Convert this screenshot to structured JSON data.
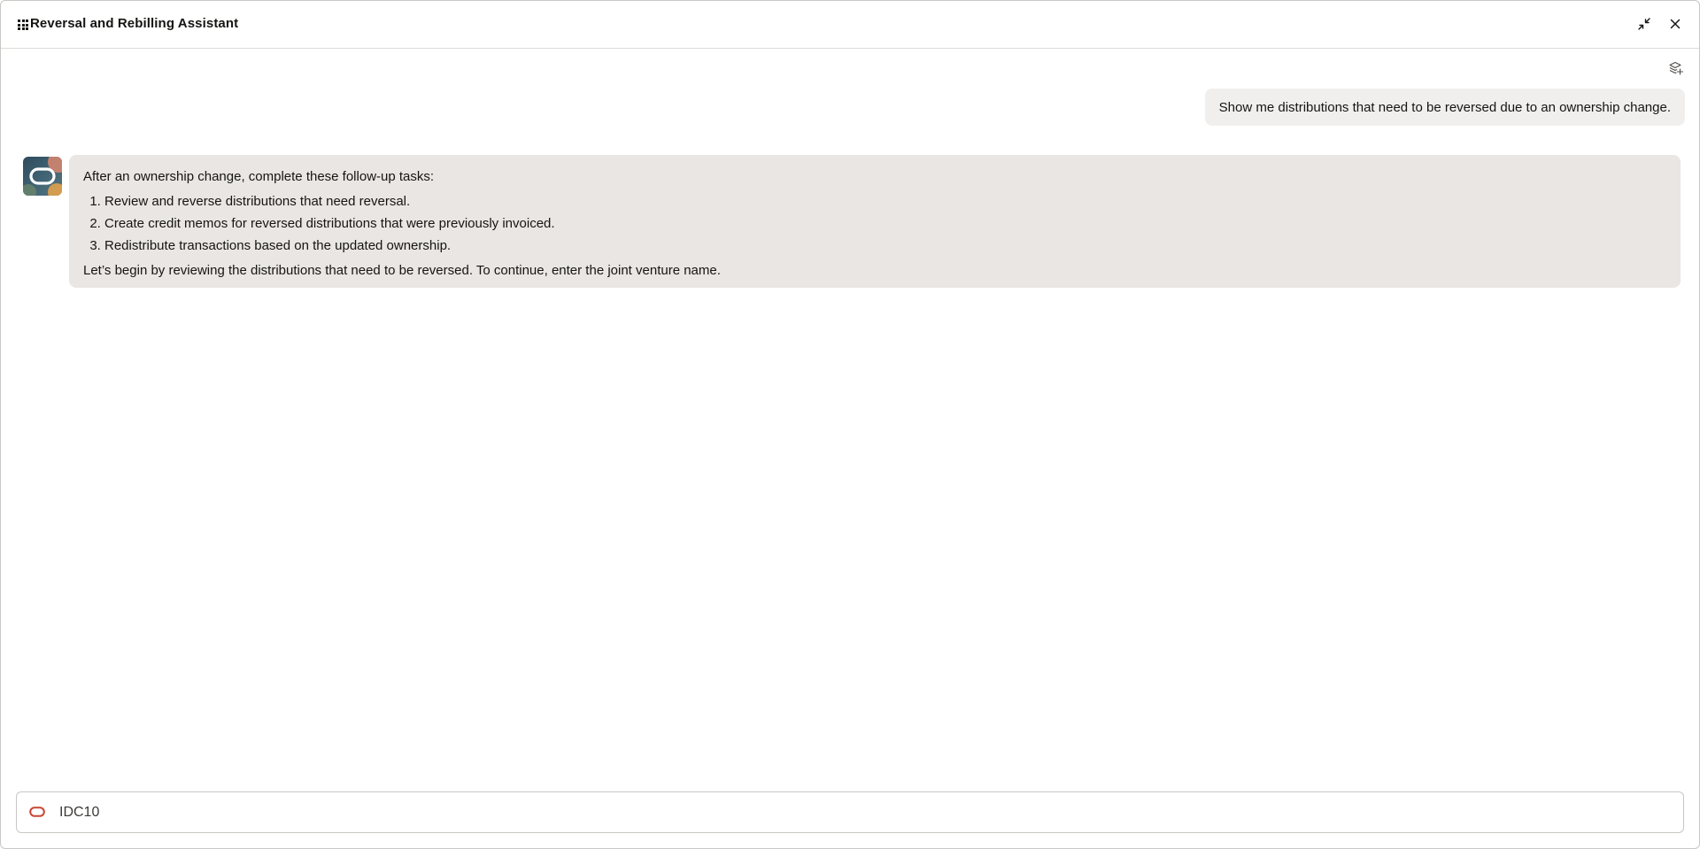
{
  "window": {
    "title": "Reversal and Rebilling Assistant"
  },
  "icons": {
    "apps": "grid-icon",
    "minimize": "minimize-arrows-icon",
    "close": "close-icon",
    "new_chat": "layers-plus-icon",
    "assistant_avatar": "oracle-assistant-avatar",
    "composer_brand": "oracle-logo-icon"
  },
  "messages": {
    "user": {
      "text": "Show me distributions that need to be reversed due to an ownership change."
    },
    "assistant": {
      "intro": "After an ownership change, complete these follow-up tasks:",
      "steps": [
        "Review and reverse distributions that need reversal.",
        "Create credit memos for reversed distributions that were previously invoiced.",
        "Redistribute transactions based on the updated ownership."
      ],
      "outro": "Let’s begin by reviewing the distributions that need to be reversed. To continue, enter the joint venture name."
    }
  },
  "composer": {
    "value": "IDC10",
    "placeholder": ""
  },
  "colors": {
    "accent": "#c74634",
    "user_bubble": "#f1efed",
    "assistant_bubble": "#e9e6e3",
    "text": "#161513"
  }
}
